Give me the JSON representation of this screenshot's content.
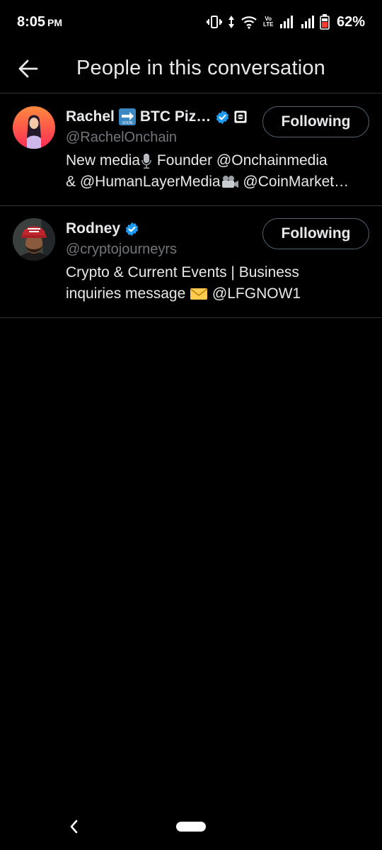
{
  "status_bar": {
    "time": "8:05",
    "ampm": "PM",
    "volte_top": "Vo",
    "volte_mid": "LTE",
    "volte_bot": "LTE",
    "battery": "62%"
  },
  "header": {
    "title": "People in this conversation"
  },
  "users": [
    {
      "name": "Rachel",
      "name_suffix": "BTC Piz…",
      "soon_label": "SOON",
      "handle": "@RachelOnchain",
      "bio_line1_a": "New media",
      "bio_line1_b": " Founder @Onchainmedia",
      "bio_line2_a": "& @HumanLayerMedia",
      "bio_line2_b": " @CoinMarket…",
      "follow_label": "Following",
      "avatar_colors": [
        "#ff7a3d",
        "#ff2a55"
      ]
    },
    {
      "name": "Rodney",
      "handle": "@cryptojourneyrs",
      "bio_line1": "Crypto & Current Events | Business",
      "bio_line2_a": "inquiries message ",
      "bio_line2_b": " @LFGNOW1",
      "follow_label": "Following",
      "hat_text": "LFG\nSTAMPING"
    }
  ],
  "colors": {
    "verified": "#1d9bf0",
    "divider": "#2f3336",
    "muted": "#71767b"
  }
}
